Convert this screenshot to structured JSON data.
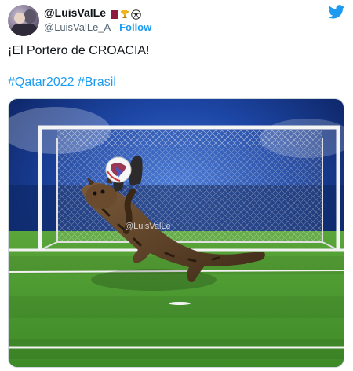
{
  "tweet": {
    "display_name": "@LuisValLe",
    "handle": "@LuisValLe_A",
    "separator": " · ",
    "follow_label": "Follow",
    "text": "¡El Portero de CROACIA!",
    "hashtags": [
      "#Qatar2022",
      "#Brasil"
    ],
    "badge_icons": [
      "qatar-flag-icon",
      "trophy-icon",
      "soccer-ball-icon"
    ]
  },
  "media": {
    "watermark": "@LuisValLe",
    "description_icon": "photo"
  },
  "colors": {
    "link": "#1d9bf0",
    "text": "#0f1419",
    "secondary": "#536471",
    "pitch": "#4f9a34",
    "sky": "#0f2e7a"
  }
}
